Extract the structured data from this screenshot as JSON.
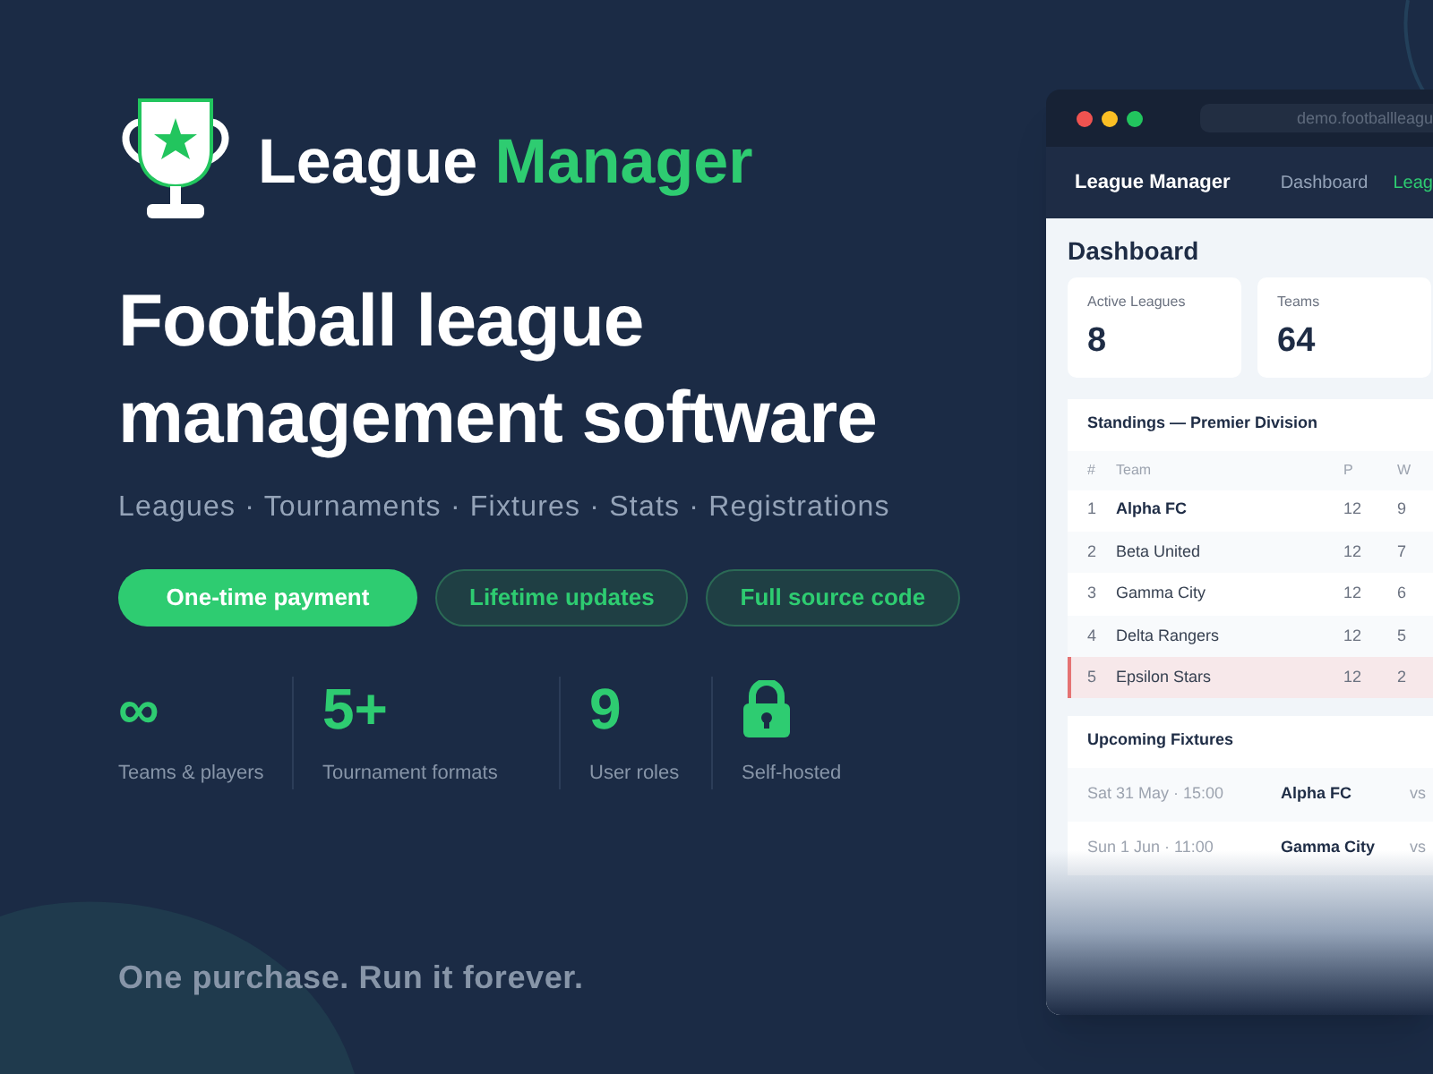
{
  "brand": {
    "title_first": "League",
    "title_second": "Manager"
  },
  "headline": "Football league management software",
  "tagline": "Leagues · Tournaments · Fixtures · Stats · Registrations",
  "pills": [
    {
      "label": "One-time payment",
      "kind": "primary"
    },
    {
      "label": "Lifetime updates",
      "kind": "outline"
    },
    {
      "label": "Full source code",
      "kind": "outline"
    }
  ],
  "stats": [
    {
      "kind": "text",
      "value": "∞",
      "label": "Teams & players"
    },
    {
      "kind": "text",
      "value": "5+",
      "label": "Tournament formats"
    },
    {
      "kind": "text",
      "value": "9",
      "label": "User roles"
    },
    {
      "kind": "lock",
      "label": "Self-hosted"
    }
  ],
  "footer_tagline": "One purchase. Run it forever.",
  "app": {
    "url": "demo.footballleagu",
    "nav": {
      "brand": "League Manager",
      "links": [
        {
          "label": "Dashboard",
          "selected": false
        },
        {
          "label": "Leag",
          "selected": true
        }
      ]
    },
    "page_title": "Dashboard",
    "cards": [
      {
        "label": "Active Leagues",
        "value": "8"
      },
      {
        "label": "Teams",
        "value": "64"
      }
    ],
    "standings": {
      "title": "Standings — Premier Division",
      "columns": [
        "#",
        "Team",
        "P",
        "W"
      ],
      "rows": [
        {
          "kind": "leader",
          "cells": [
            "1",
            "Alpha FC",
            "12",
            "9"
          ]
        },
        {
          "kind": "normal",
          "cells": [
            "2",
            "Beta United",
            "12",
            "7"
          ]
        },
        {
          "kind": "normal",
          "cells": [
            "3",
            "Gamma City",
            "12",
            "6"
          ]
        },
        {
          "kind": "normal",
          "cells": [
            "4",
            "Delta Rangers",
            "12",
            "5"
          ]
        },
        {
          "kind": "relegation",
          "cells": [
            "5",
            "Epsilon Stars",
            "12",
            "2"
          ]
        }
      ]
    },
    "fixtures": {
      "title": "Upcoming Fixtures",
      "rows": [
        {
          "time": "Sat 31 May · 15:00",
          "home": "Alpha FC",
          "vs": "vs"
        },
        {
          "time": "Sun 1 Jun · 11:00",
          "home": "Gamma City",
          "vs": "vs"
        }
      ]
    }
  }
}
